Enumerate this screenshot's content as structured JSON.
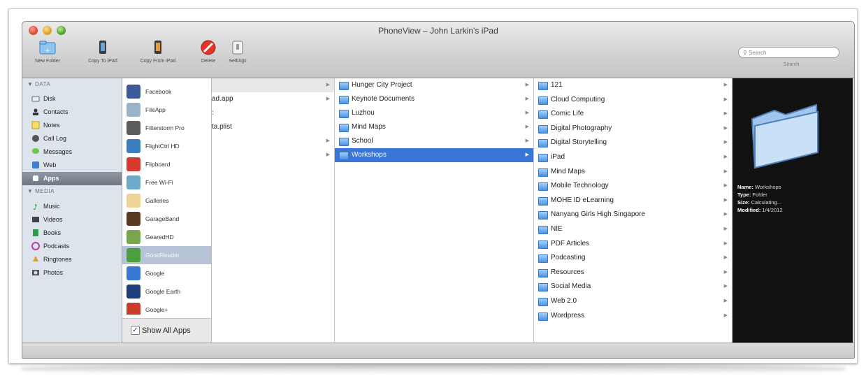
{
  "window": {
    "title": "PhoneView – John Larkin's iPad"
  },
  "toolbar": {
    "new_folder": "New Folder",
    "copy_to": "Copy To iPad",
    "copy_from": "Copy From iPad",
    "delete": "Delete",
    "settings": "Settings"
  },
  "search": {
    "placeholder": "Search",
    "label": "Search"
  },
  "sidebar": {
    "data_header": "▼ DATA",
    "media_header": "▼ MEDIA",
    "data_items": [
      {
        "label": "Disk",
        "icon": "disk-icon"
      },
      {
        "label": "Contacts",
        "icon": "contacts-icon"
      },
      {
        "label": "Notes",
        "icon": "notes-icon"
      },
      {
        "label": "Call Log",
        "icon": "call-log-icon"
      },
      {
        "label": "Messages",
        "icon": "messages-icon"
      },
      {
        "label": "Web",
        "icon": "web-icon"
      },
      {
        "label": "Apps",
        "icon": "apps-icon"
      }
    ],
    "media_items": [
      {
        "label": "Music",
        "icon": "music-icon"
      },
      {
        "label": "Videos",
        "icon": "videos-icon"
      },
      {
        "label": "Books",
        "icon": "books-icon"
      },
      {
        "label": "Podcasts",
        "icon": "podcasts-icon"
      },
      {
        "label": "Ringtones",
        "icon": "ringtones-icon"
      },
      {
        "label": "Photos",
        "icon": "photos-icon"
      }
    ],
    "selected": "Apps"
  },
  "apps": {
    "items": [
      "Facebook",
      "FileApp",
      "Filterstorm Pro",
      "FlightCtrl HD",
      "Flipboard",
      "Free Wi-Fi",
      "Galleries",
      "GarageBand",
      "GearedHD",
      "GoodReader",
      "Google",
      "Google Earth",
      "Google+"
    ],
    "selected": "GoodReader",
    "show_all_label": "Show All Apps",
    "show_all_checked": true
  },
  "column1": {
    "items": [
      "ad.app",
      ":",
      "ta.plist"
    ]
  },
  "column2": {
    "items": [
      "Hunger City Project",
      "Keynote Documents",
      "Luzhou",
      "Mind Maps",
      "School",
      "Workshops"
    ],
    "selected": "Workshops"
  },
  "column3": {
    "items": [
      "121",
      "Cloud Computing",
      "Comic Life",
      "Digital Photography",
      "Digital Storytelling",
      "iPad",
      "Mind Maps",
      "Mobile Technology",
      "MOHE ID eLearning",
      "Nanyang Girls High Singapore",
      "NIE",
      "PDF Articles",
      "Podcasting",
      "Resources",
      "Social Media",
      "Web 2.0",
      "Wordpress"
    ]
  },
  "preview": {
    "name_label": "Name:",
    "name_value": "Workshops",
    "type_label": "Type:",
    "type_value": "Folder",
    "size_label": "Size:",
    "size_value": "Calculating...",
    "modified_label": "Modified:",
    "modified_value": "1/4/2012"
  },
  "colors": {
    "selection": "#3875d7",
    "sidebar_bg": "#dde4ec",
    "preview_bg": "#111111"
  }
}
